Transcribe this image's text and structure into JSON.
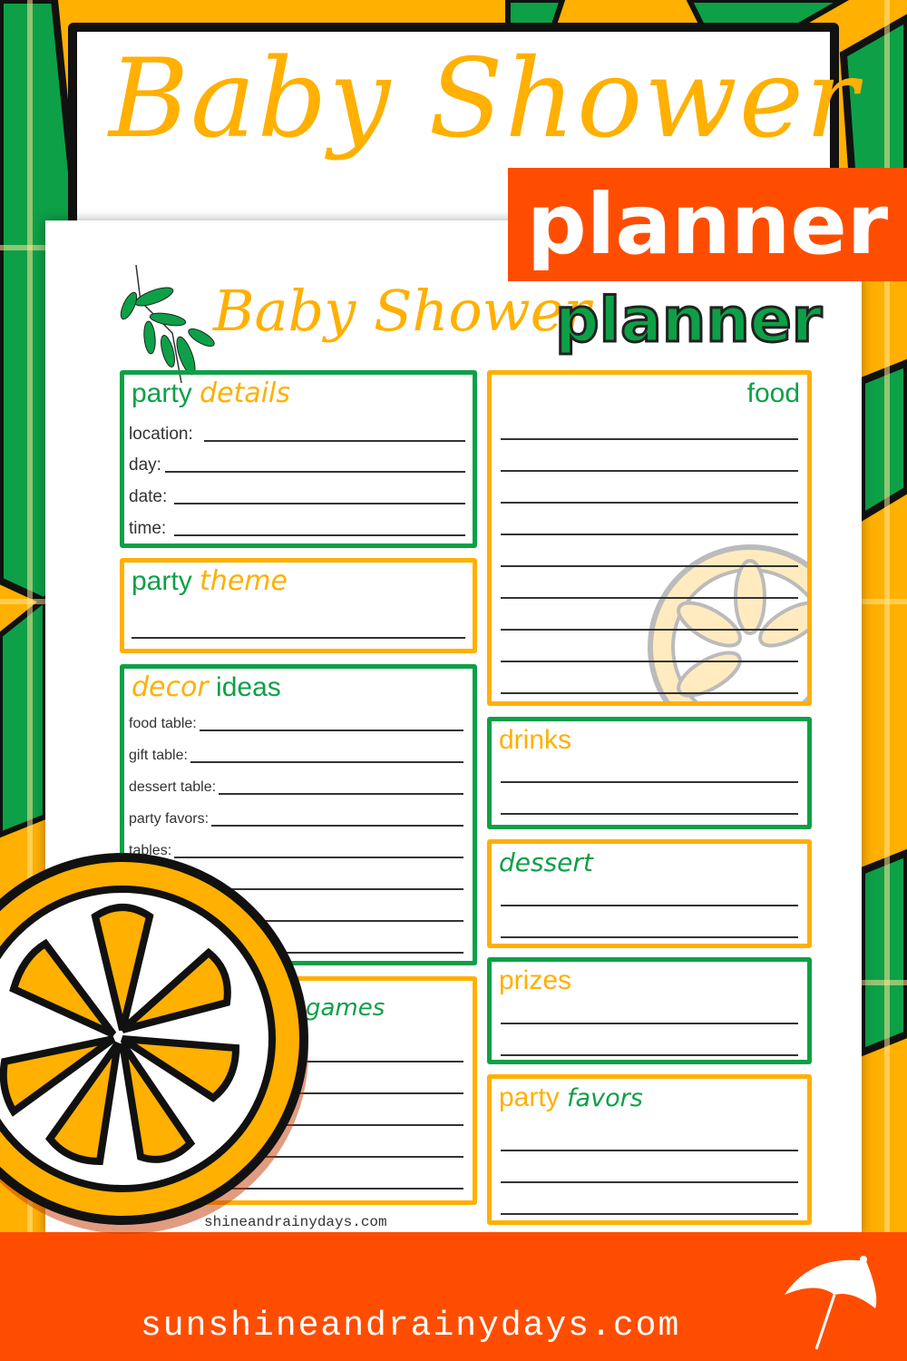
{
  "header": {
    "title_script": "Baby Shower",
    "title_banner": "planner"
  },
  "sheet": {
    "title_script": "Baby Shower",
    "title_bold": "planner",
    "sections": {
      "party_details": {
        "word1": "party",
        "word2": "details",
        "fields": [
          "location:",
          "day:",
          "date:",
          "time:"
        ]
      },
      "party_theme": {
        "word1": "party",
        "word2": "theme"
      },
      "decor_ideas": {
        "word1": "decor",
        "word2": "ideas",
        "fields": [
          "food table:",
          "gift table:",
          "dessert table:",
          "party favors:",
          "tables:"
        ]
      },
      "games": {
        "word2": "games"
      },
      "food": {
        "word1": "food"
      },
      "drinks": {
        "word1": "drinks"
      },
      "dessert": {
        "word1": "dessert"
      },
      "prizes": {
        "word1": "prizes"
      },
      "party_favors": {
        "word1": "party",
        "word2": "favors"
      }
    },
    "watermark": "shineandrainydays.com"
  },
  "footer": {
    "url": "sunshineandrainydays.com"
  },
  "colors": {
    "green": "#0da047",
    "yellow": "#ffb000",
    "orange": "#ff4d00"
  }
}
